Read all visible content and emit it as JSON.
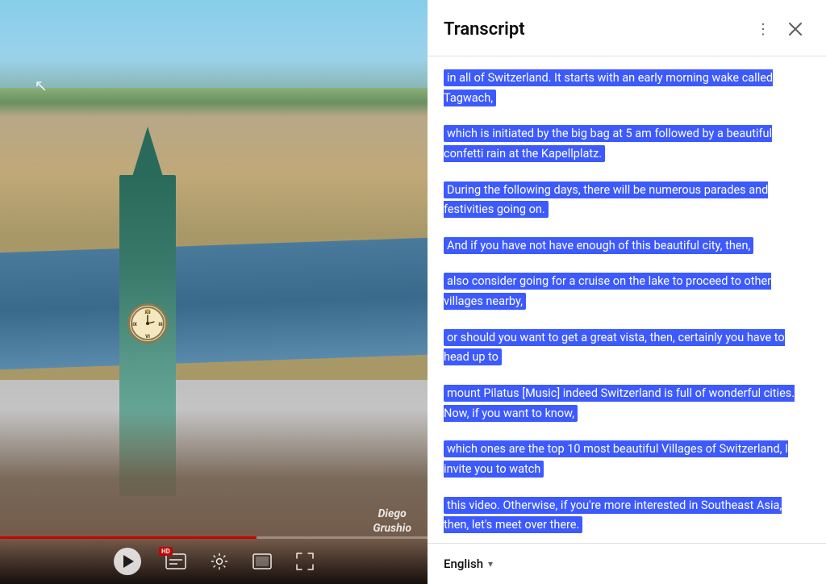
{
  "transcript": {
    "title": "Transcript",
    "segments": [
      {
        "id": 1,
        "text": "in all of Switzerland. It starts with  an early morning wake called Tagwach,"
      },
      {
        "id": 2,
        "text": "which is initiated by the big bag at 5 am followed  by a beautiful confetti rain at the Kapellplatz."
      },
      {
        "id": 3,
        "text": "During the following days, there will be  numerous parades and festivities going on."
      },
      {
        "id": 4,
        "text": "And if you have not have enough  of this beautiful city, then,"
      },
      {
        "id": 5,
        "text": "also consider going for a cruise on the  lake to proceed to other villages nearby,"
      },
      {
        "id": 6,
        "text": "or should you want to get a great vista,  then, certainly you have to head up to"
      },
      {
        "id": 7,
        "text": "mount Pilatus [Music] indeed Switzerland is full  of wonderful cities. Now, if you want to know,"
      },
      {
        "id": 8,
        "text": "which ones are the top 10 most beautiful  Villages of Switzerland, I invite you to watch"
      },
      {
        "id": 9,
        "text": "this video. Otherwise, if you're more interested  in Southeast Asia, then, let's meet over there."
      }
    ],
    "close_label": "✕",
    "more_options_label": "⋮"
  },
  "language": {
    "selected": "English",
    "chevron": "▾"
  },
  "video": {
    "watermark_line1": "Diego",
    "watermark_line2": "Grushio",
    "hd_badge": "HD",
    "controls": {
      "subtitles_icon": "subtitles",
      "settings_icon": "settings",
      "theater_icon": "theater",
      "fullscreen_icon": "fullscreen"
    }
  }
}
